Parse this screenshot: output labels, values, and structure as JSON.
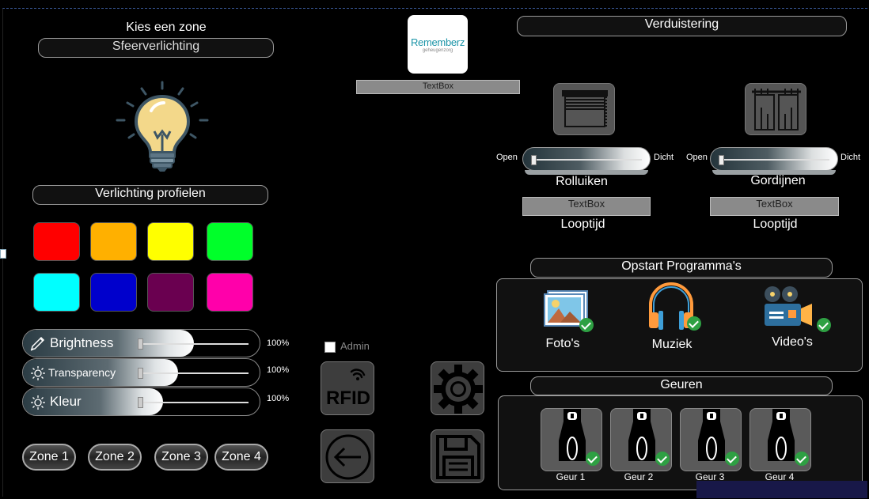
{
  "zone": {
    "title": "Kies een zone",
    "selected": "Sfeerverlichting"
  },
  "logo": {
    "brand": "Rememberz",
    "tagline": "geheugenzorg"
  },
  "top_textbox": "TextBox",
  "lighting": {
    "profiles_title": "Verlichting profielen",
    "swatches": [
      "#ff0000",
      "#ffb000",
      "#ffff00",
      "#00ff2a",
      "#00ffff",
      "#0000cc",
      "#6a0050",
      "#ff00aa"
    ],
    "sliders": [
      {
        "label": "Brightness",
        "value": "100%",
        "icon": "brush-icon",
        "level": 1.0
      },
      {
        "label": "Transparency",
        "value": "100%",
        "icon": "sun-icon",
        "level": 1.0
      },
      {
        "label": "Kleur",
        "value": "100%",
        "icon": "sun-icon",
        "level": 1.0
      }
    ],
    "zones": [
      "Zone 1",
      "Zone 2",
      "Zone 3",
      "Zone 4"
    ]
  },
  "admin": {
    "label": "Admin",
    "checked": false
  },
  "buttons": {
    "rfid": "RFID",
    "settings_icon": "gear-icon",
    "back_icon": "arrow-left-icon",
    "save_icon": "floppy-disk-icon"
  },
  "darkening": {
    "title": "Verduistering",
    "shades": [
      {
        "name": "Rolluiken",
        "open": "Open",
        "close": "Dicht",
        "textbox": "TextBox",
        "runtime": "Looptijd",
        "icon": "roller-shutter-icon"
      },
      {
        "name": "Gordijnen",
        "open": "Open",
        "close": "Dicht",
        "textbox": "TextBox",
        "runtime": "Looptijd",
        "icon": "curtains-icon"
      }
    ]
  },
  "programs": {
    "title": "Opstart Programma's",
    "items": [
      {
        "label": "Foto's",
        "icon": "photos-icon"
      },
      {
        "label": "Muziek",
        "icon": "headphones-icon"
      },
      {
        "label": "Video's",
        "icon": "film-camera-icon"
      }
    ]
  },
  "scents": {
    "title": "Geuren",
    "items": [
      "Geur 1",
      "Geur 2",
      "Geur 3",
      "Geur 4"
    ]
  }
}
